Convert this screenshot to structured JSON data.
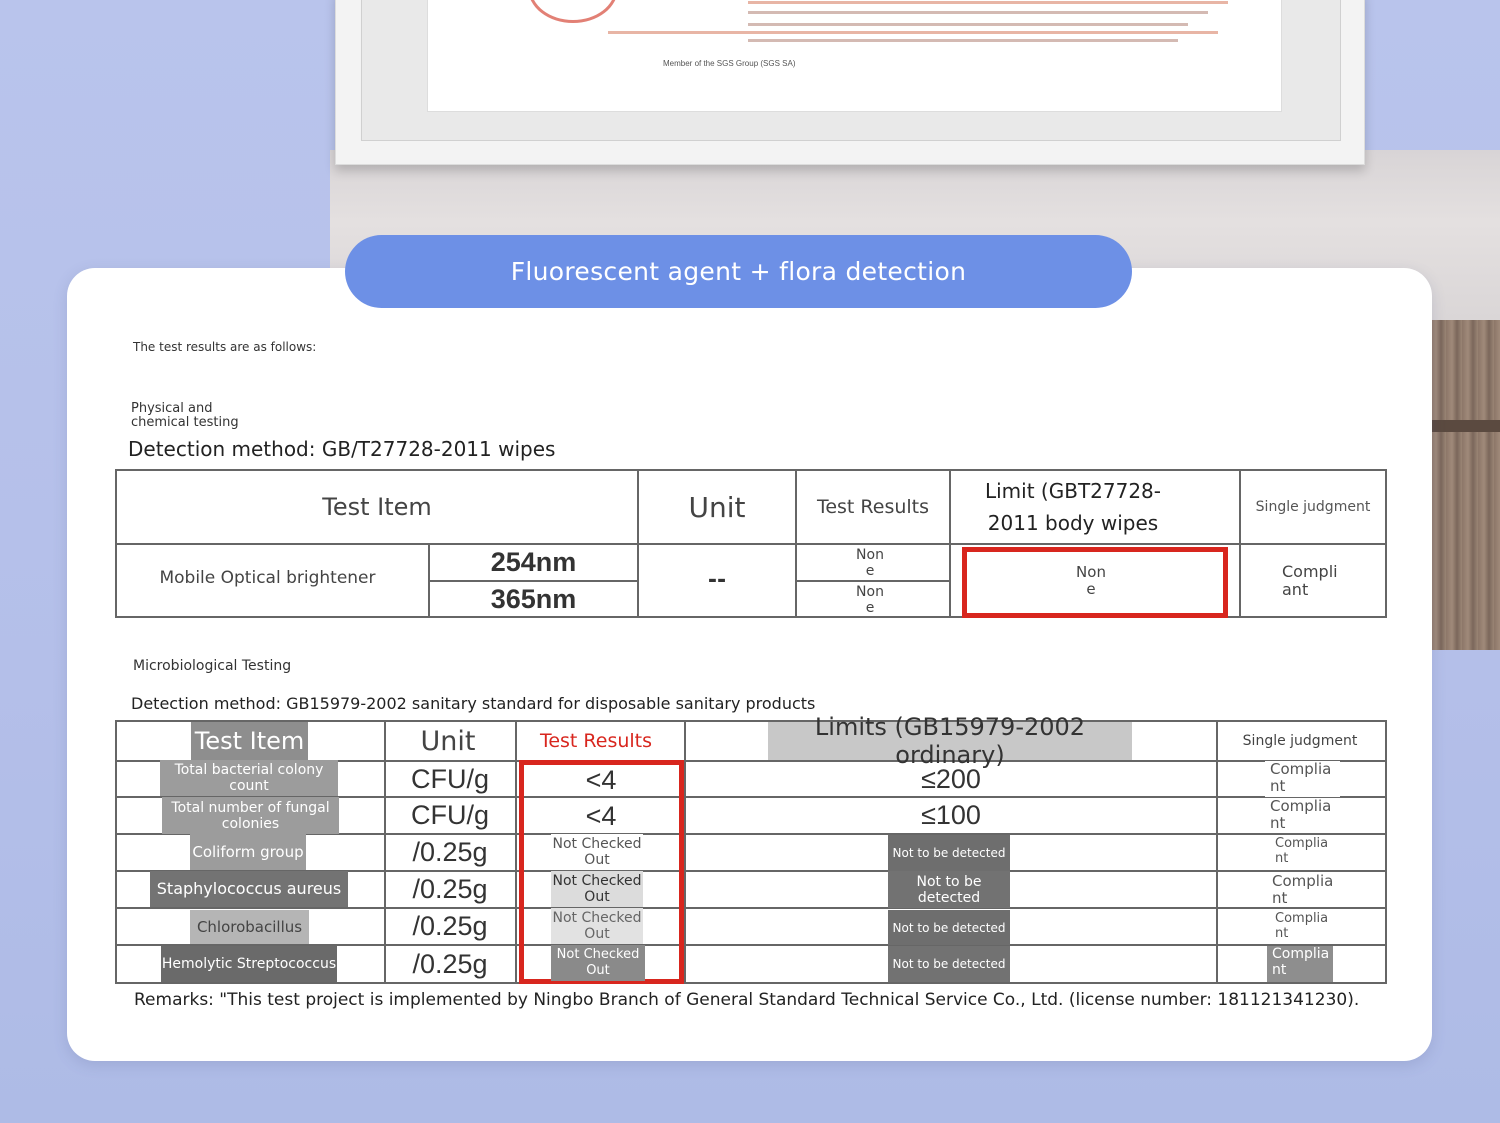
{
  "banner": {
    "title": "Fluorescent agent + flora detection"
  },
  "intro": "The test results are as follows:",
  "certificate": {
    "caption": "Member of the SGS Group (SGS SA)"
  },
  "physical": {
    "section_title": "Physical and chemical testing",
    "method": "Detection method: GB/T27728-2011 wipes",
    "headers": [
      "Test Item",
      "Unit",
      "Test Results",
      "Limit (GBT27728-2011 body wipes",
      "Single judgment"
    ],
    "item": "Mobile Optical brightener",
    "wavelengths": [
      "254nm",
      "365nm"
    ],
    "unit": "--",
    "results": [
      "None",
      "None"
    ],
    "limit": "None",
    "judgment": "Compliant"
  },
  "micro": {
    "section_title": "Microbiological Testing",
    "method": "Detection method: GB15979-2002 sanitary standard for disposable sanitary products",
    "headers": [
      "Test Item",
      "Unit",
      "Test Results",
      "Limits (GB15979-2002 ordinary)",
      "Single judgment"
    ],
    "rows": [
      {
        "item": "Total bacterial colony count",
        "unit": "CFU/g",
        "result": "<4",
        "limit": "≤200",
        "judgment": "Compliant"
      },
      {
        "item": "Total number of fungal colonies",
        "unit": "CFU/g",
        "result": "<4",
        "limit": "≤100",
        "judgment": "Compliant"
      },
      {
        "item": "Coliform group",
        "unit": "/0.25g",
        "result": "Not Checked Out",
        "limit": "Not to be detected",
        "judgment": "Compliant"
      },
      {
        "item": "Staphylococcus aureus",
        "unit": "/0.25g",
        "result": "Not Checked Out",
        "limit": "Not to be detected",
        "judgment": "Compliant"
      },
      {
        "item": "Chlorobacillus",
        "unit": "/0.25g",
        "result": "Not Checked Out",
        "limit": "Not to be detected",
        "judgment": "Compliant"
      },
      {
        "item": "Hemolytic Streptococcus",
        "unit": "/0.25g",
        "result": "Not Checked Out",
        "limit": "Not to be detected",
        "judgment": "Compliant"
      }
    ]
  },
  "remarks": "Remarks: \"This test project is implemented by Ningbo Branch of General Standard Technical Service Co., Ltd. (license number: 181121341230)."
}
